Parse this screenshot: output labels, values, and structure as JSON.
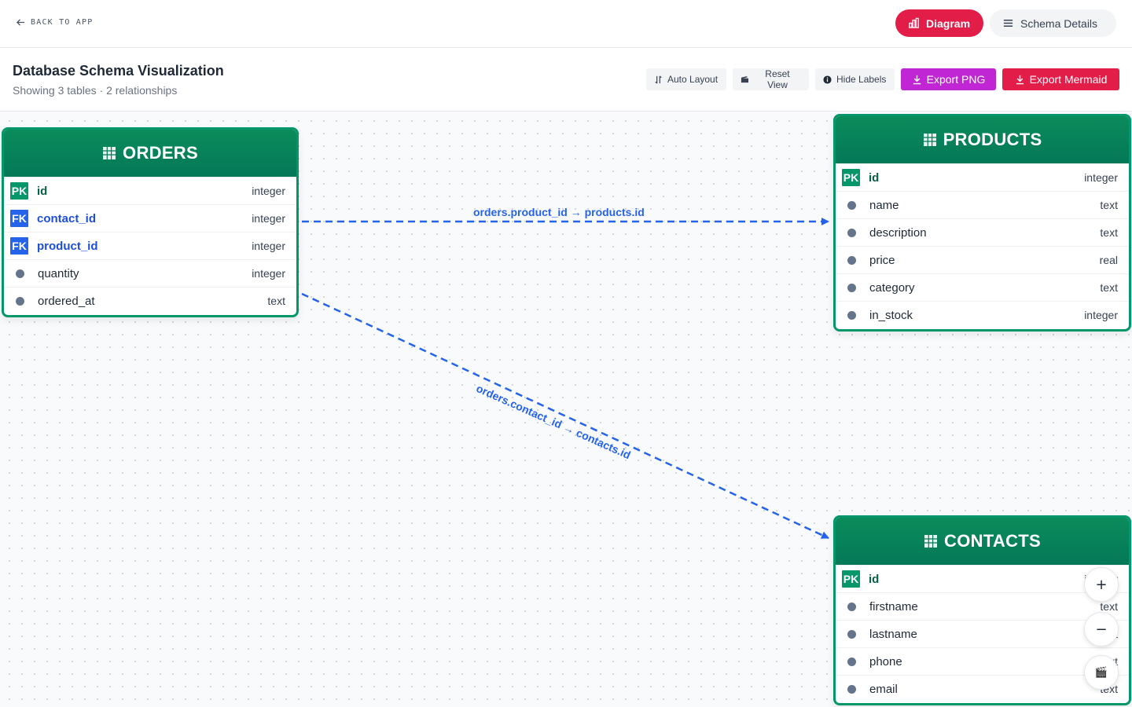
{
  "topbar": {
    "back_label": "BACK TO APP",
    "diagram_label": "Diagram",
    "schema_label": "Schema Details"
  },
  "header": {
    "title": "Database Schema Visualization",
    "subtitle": "Showing 3 tables · 2 relationships"
  },
  "toolbar": {
    "auto_layout": "Auto Layout",
    "reset_view": "Reset View",
    "hide_labels": "Hide Labels",
    "export_png": "Export PNG",
    "export_mermaid": "Export Mermaid"
  },
  "tables": {
    "orders": {
      "name": "ORDERS",
      "columns": [
        {
          "name": "id",
          "type": "integer",
          "key": "PK"
        },
        {
          "name": "contact_id",
          "type": "integer",
          "key": "FK"
        },
        {
          "name": "product_id",
          "type": "integer",
          "key": "FK"
        },
        {
          "name": "quantity",
          "type": "integer",
          "key": ""
        },
        {
          "name": "ordered_at",
          "type": "text",
          "key": ""
        }
      ]
    },
    "products": {
      "name": "PRODUCTS",
      "columns": [
        {
          "name": "id",
          "type": "integer",
          "key": "PK"
        },
        {
          "name": "name",
          "type": "text",
          "key": ""
        },
        {
          "name": "description",
          "type": "text",
          "key": ""
        },
        {
          "name": "price",
          "type": "real",
          "key": ""
        },
        {
          "name": "category",
          "type": "text",
          "key": ""
        },
        {
          "name": "in_stock",
          "type": "integer",
          "key": ""
        }
      ]
    },
    "contacts": {
      "name": "CONTACTS",
      "columns": [
        {
          "name": "id",
          "type": "integer",
          "key": "PK"
        },
        {
          "name": "firstname",
          "type": "text",
          "key": ""
        },
        {
          "name": "lastname",
          "type": "text",
          "key": ""
        },
        {
          "name": "phone",
          "type": "text",
          "key": ""
        },
        {
          "name": "email",
          "type": "text",
          "key": ""
        }
      ]
    }
  },
  "relationships": [
    {
      "label": "orders.product_id → products.id"
    },
    {
      "label": "orders.contact_id → contacts.id"
    }
  ],
  "zoom": {
    "zoom_in": "+",
    "zoom_out": "−",
    "fit": "🎬"
  },
  "colors": {
    "accent": "#e11d48",
    "export_png": "#c026d3",
    "table_header": "#047857",
    "relation": "#2563eb"
  }
}
